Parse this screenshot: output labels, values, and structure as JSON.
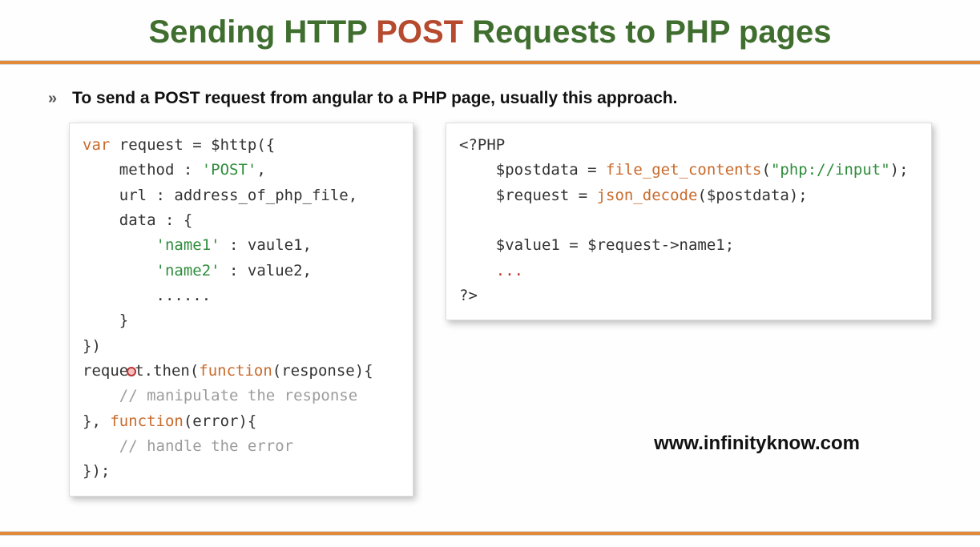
{
  "title": {
    "part1": "Sending HTTP ",
    "part2": "POST",
    "part3": " Requests to PHP pages"
  },
  "bullet": {
    "marker": "»",
    "text": "To send a POST request from angular to a PHP page, usually this approach."
  },
  "code_left": {
    "l1a": "var",
    "l1b": " request = $http({",
    "l2a": "    method : ",
    "l2b": "'POST'",
    "l2c": ",",
    "l3": "    url : address_of_php_file,",
    "l4": "    data : {",
    "l5a": "        ",
    "l5b": "'name1'",
    "l5c": " : vaule1,",
    "l6a": "        ",
    "l6b": "'name2'",
    "l6c": " : value2,",
    "l7": "        ......",
    "l8": "    }",
    "l9": "})",
    "l10a": "reque",
    "l10b": "t.then(",
    "l10c": "function",
    "l10d": "(response){",
    "l11a": "    ",
    "l11b": "// manipulate the response",
    "l12a": "}, ",
    "l12b": "function",
    "l12c": "(error){",
    "l13a": "    ",
    "l13b": "// handle the error",
    "l14": "});"
  },
  "code_right": {
    "l1": "<?PHP",
    "l2a": "    $postdata = ",
    "l2b": "file_get_contents",
    "l2c": "(",
    "l2d": "\"php://input\"",
    "l2e": ");",
    "l3a": "    $request = ",
    "l3b": "json_decode",
    "l3c": "($postdata);",
    "l4": "",
    "l5": "    $value1 = $request->name1;",
    "l6": "    ...",
    "l7": "?>"
  },
  "watermark": "www.infinityknow.com"
}
